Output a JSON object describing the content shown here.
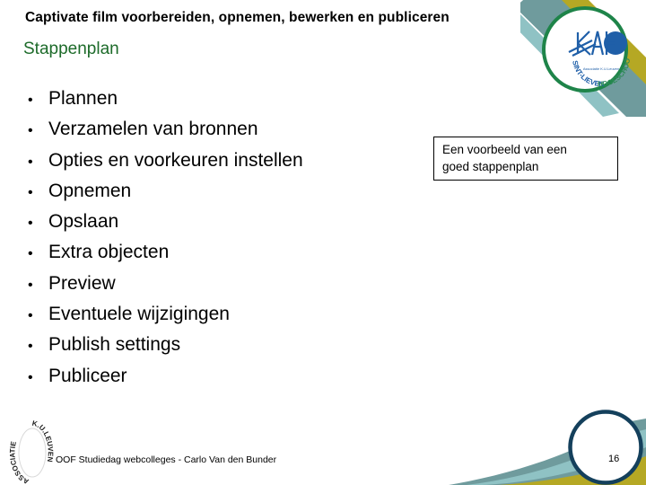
{
  "slide": {
    "title": "Captivate film voorbereiden, opnemen, bewerken en publiceren",
    "subtitle": "Stappenplan",
    "page_number": "16",
    "subtitle_color": "#1d6b2a",
    "background_color": "#ffffff"
  },
  "steps": [
    {
      "bullet": "•",
      "label": "Plannen"
    },
    {
      "bullet": "•",
      "label": "Verzamelen van bronnen"
    },
    {
      "bullet": "•",
      "label": "Opties en voorkeuren instellen"
    },
    {
      "bullet": "•",
      "label": "Opnemen"
    },
    {
      "bullet": "•",
      "label": "Opslaan"
    },
    {
      "bullet": "•",
      "label": "Extra objecten"
    },
    {
      "bullet": "•",
      "label": "Preview"
    },
    {
      "bullet": "•",
      "label": "Eventuele wijzigingen"
    },
    {
      "bullet": "•",
      "label": "Publish settings"
    },
    {
      "bullet": "•",
      "label": "Publiceer"
    }
  ],
  "callout": {
    "line1": "Een voorbeeld van een",
    "line2": "goed stappenplan"
  },
  "footer": {
    "text": "OOF Studiedag webcolleges -  Carlo Van den Bunder"
  },
  "logos": {
    "kaho": {
      "name": "kaho-sint-lieven-hogeschool-logo",
      "wordmark_left": "SINT-LIEVEN",
      "wordmark_right": "HOGESCHOOL",
      "monogram": "KAHO",
      "subline": "Associatie K.U.Leuven",
      "ring_color": "#1e8449",
      "disc_color": "#1f5fa8"
    },
    "ku_leuven": {
      "name": "associatie-ku-leuven-logo",
      "text_left": "ASSOCIATIE",
      "text_right": "K.U.LEUVEN"
    }
  },
  "decoration": {
    "gold_band_color": "#b5a824",
    "teal_band_color": "#6f9b9d",
    "dark_ring_color": "#1b3d5c",
    "light_teal_color": "#8fc2c4",
    "circle_outline_color": "#14405c"
  }
}
